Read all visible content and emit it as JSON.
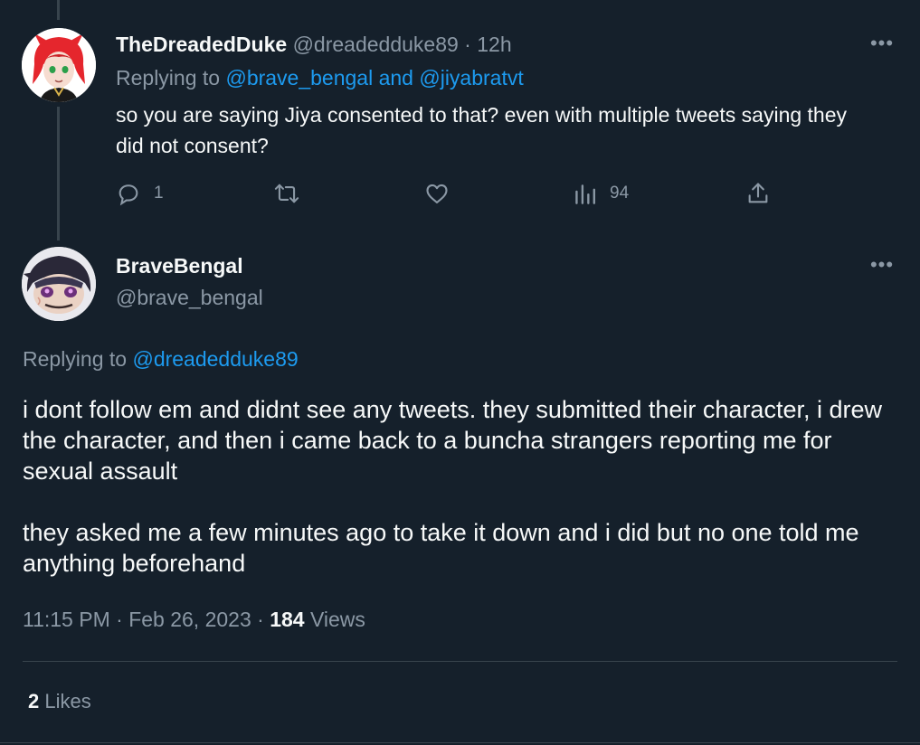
{
  "reply_tweet": {
    "display_name": "TheDreadedDuke",
    "handle": "@dreadedduke89",
    "separator": "·",
    "time": "12h",
    "replying_prefix": "Replying to",
    "replying_users": "@brave_bengal and @jiyabratvt",
    "text": "so you are saying Jiya consented to that? even with multiple tweets saying they did not consent?",
    "more_label": "•••",
    "actions": {
      "reply_count": "1",
      "retweet_count": "",
      "like_count": "",
      "views_count": "94"
    }
  },
  "main_tweet": {
    "display_name": "BraveBengal",
    "handle": "@brave_bengal",
    "more_label": "•••",
    "replying_prefix": "Replying to",
    "replying_user": "@dreadedduke89",
    "paragraphs": [
      "i dont follow em and didnt see any tweets. they submitted their character, i drew the character, and then i came back to a buncha strangers reporting me for sexual assault",
      "they asked me a few minutes ago to take it down and i did but no one told me anything beforehand"
    ],
    "time": "11:15 PM",
    "separator": "·",
    "date": "Feb 26, 2023",
    "views_count": "184",
    "views_label": "Views",
    "likes_count": "2",
    "likes_label": "Likes"
  },
  "icons": {
    "reply": "reply-icon",
    "retweet": "retweet-icon",
    "like": "heart-icon",
    "views": "analytics-icon",
    "share": "share-icon"
  },
  "colors": {
    "background": "#15202b",
    "text": "#f7f9f9",
    "muted": "#8b98a5",
    "link": "#1d9bf0",
    "border": "#38444d"
  }
}
